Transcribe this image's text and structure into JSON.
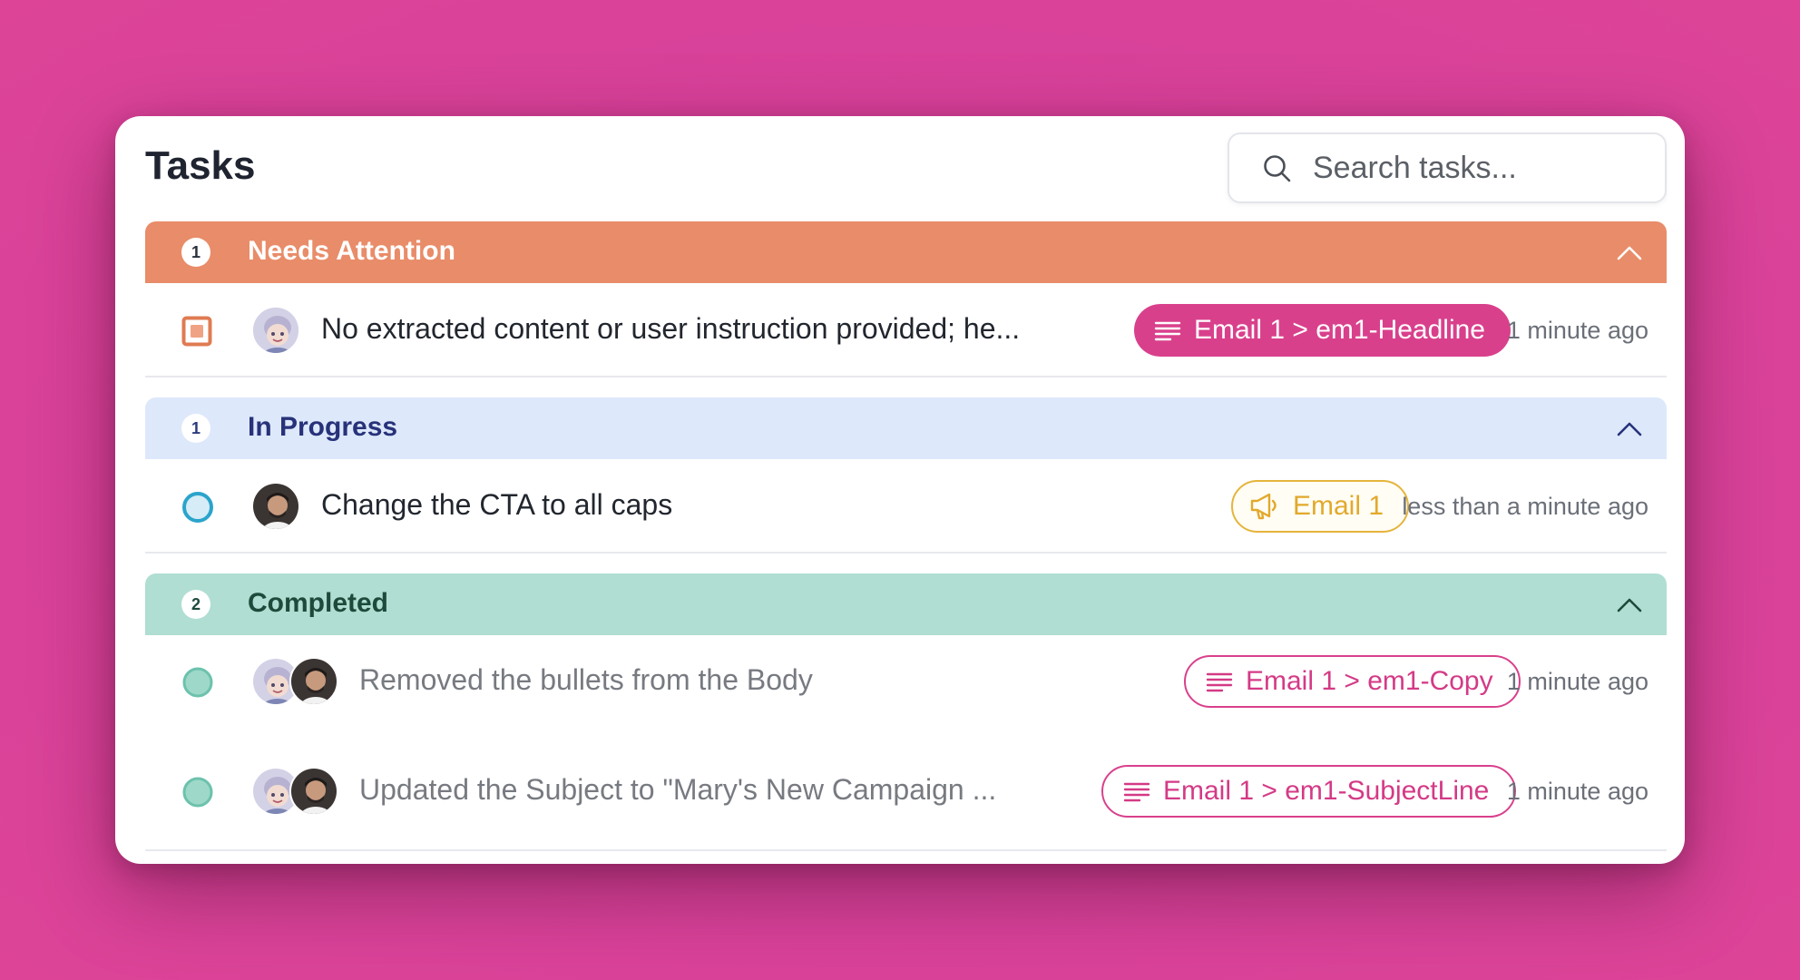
{
  "app": {
    "title": "Tasks",
    "search": {
      "placeholder": "Search tasks..."
    }
  },
  "colors": {
    "background": "#d8419a",
    "needs_attention": "#e98c69",
    "in_progress": "#dde8fb",
    "completed": "#b0ded2",
    "tag_pink": "#d9408c",
    "tag_yellow": "#e6b43c"
  },
  "sections": {
    "needs_attention": {
      "count": "1",
      "label": "Needs Attention",
      "tasks": [
        {
          "text": "No extracted content or user instruction provided; he...",
          "tag": "Email 1 > em1-Headline",
          "time": "1 minute ago",
          "status_icon": "square-checkbox-icon"
        }
      ]
    },
    "in_progress": {
      "count": "1",
      "label": "In Progress",
      "tasks": [
        {
          "text": "Change the CTA to all caps",
          "tag": "Email 1",
          "time": "less than a minute ago",
          "status_icon": "in-progress-circle-icon"
        }
      ]
    },
    "completed": {
      "count": "2",
      "label": "Completed",
      "tasks": [
        {
          "text": "Removed the bullets from the Body",
          "tag": "Email 1 > em1-Copy",
          "time": "1 minute ago",
          "status_icon": "completed-circle-icon"
        },
        {
          "text": "Updated the Subject to \"Mary's New Campaign ...",
          "tag": "Email 1 > em1-SubjectLine",
          "time": "1 minute ago",
          "status_icon": "completed-circle-icon"
        }
      ]
    }
  }
}
